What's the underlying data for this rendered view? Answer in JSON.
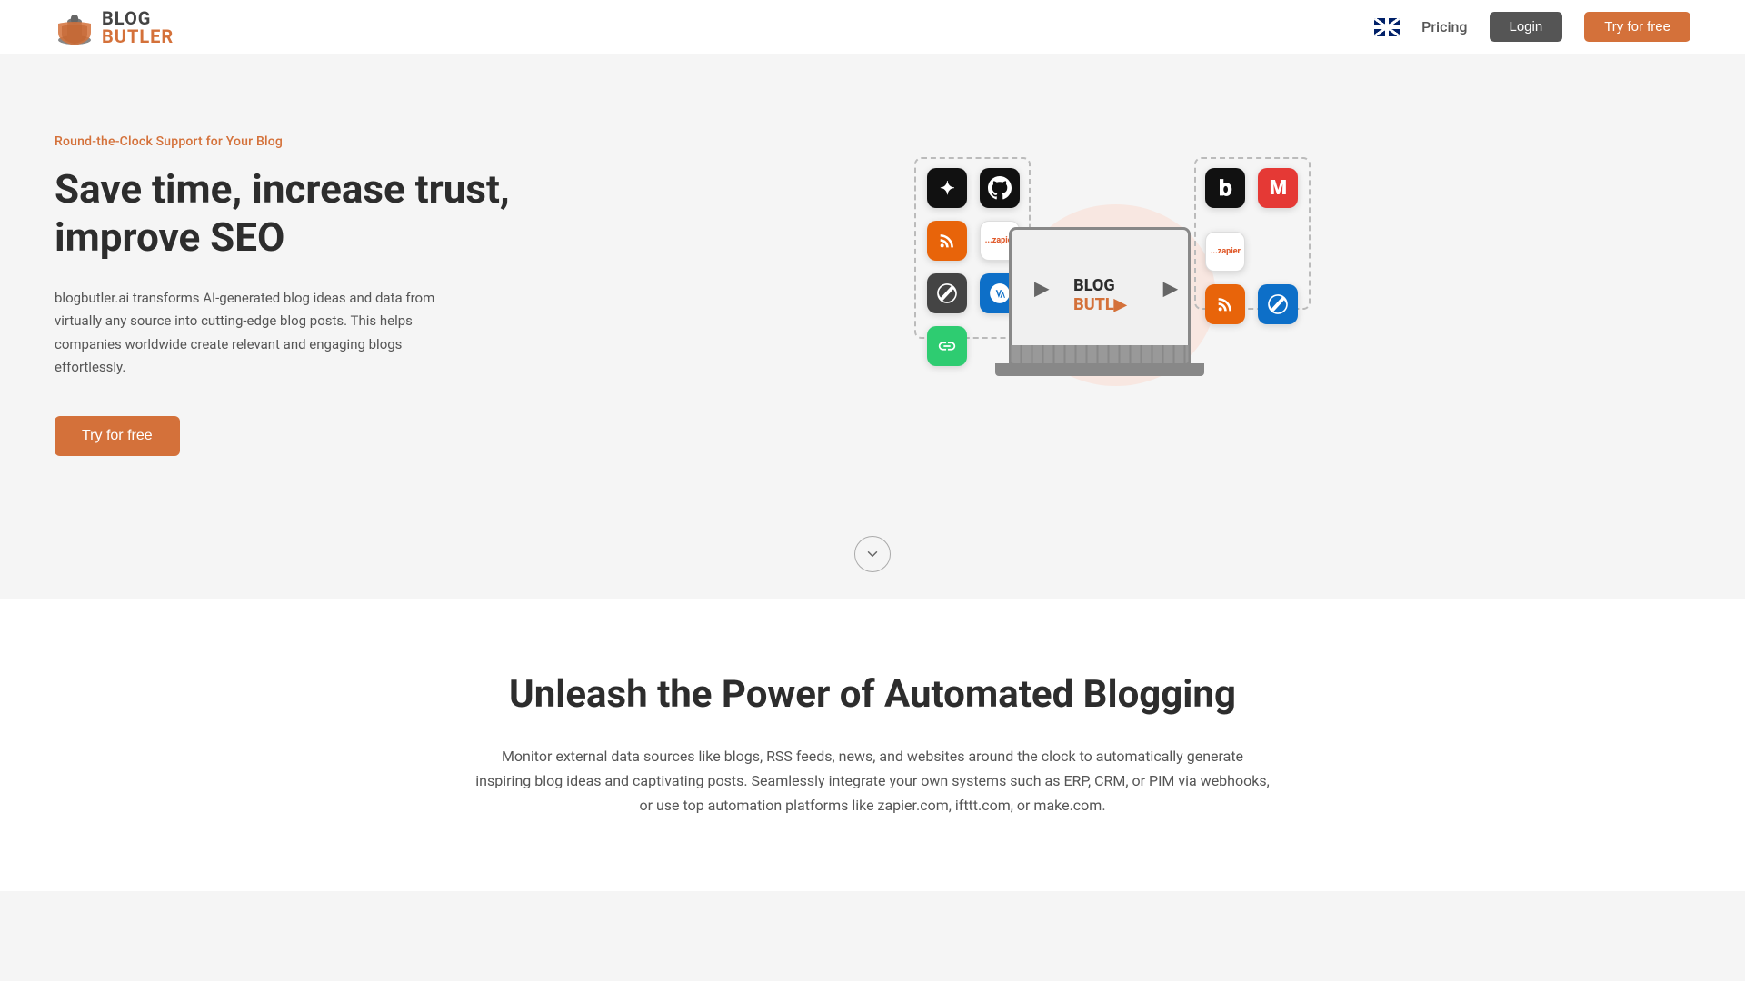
{
  "nav": {
    "logo_blog": "BLOG",
    "logo_butler": "BUTLER",
    "pricing_label": "Pricing",
    "login_label": "Login",
    "try_free_label": "Try for free"
  },
  "hero": {
    "tagline": "Round-the-Clock Support for Your Blog",
    "title_line1": "Save time, increase trust,",
    "title_line2": "improve SEO",
    "description": "blogbutler.ai transforms AI-generated blog ideas and data from virtually any source into cutting-edge blog posts. This helps companies worldwide create relevant and engaging blogs effortlessly.",
    "try_free_label": "Try for free"
  },
  "section2": {
    "title": "Unleash the Power of Automated Blogging",
    "description": "Monitor external data sources like blogs, RSS feeds, news, and websites around the clock to automatically generate inspiring blog ideas and captivating posts. Seamlessly integrate your own systems such as ERP, CRM, or PIM via webhooks, or use top automation platforms like zapier.com, ifttt.com, or make.com."
  },
  "scroll": {
    "icon": "chevron-down"
  }
}
